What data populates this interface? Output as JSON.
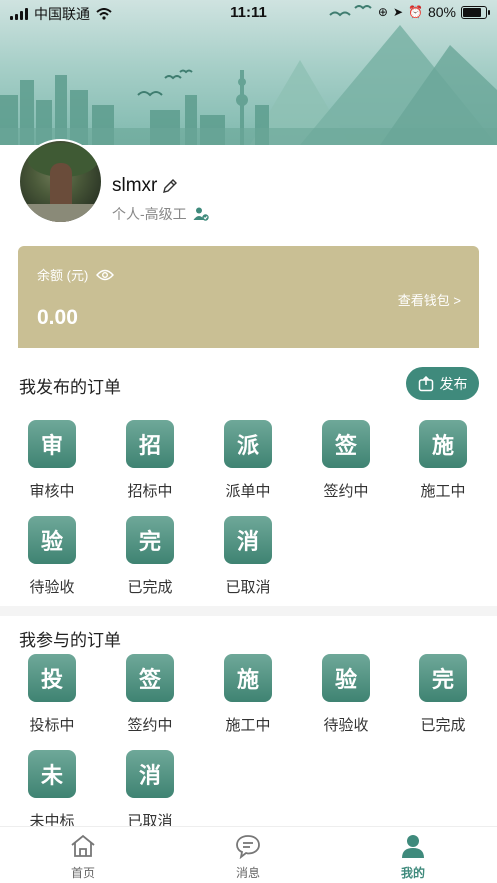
{
  "status_bar": {
    "carrier": "中国联通",
    "time": "11:11",
    "battery": "80%"
  },
  "profile": {
    "username": "slmxr",
    "role": "个人-高级工"
  },
  "balance": {
    "label": "余额 (元)",
    "value": "0.00",
    "wallet_link": "查看钱包 >"
  },
  "published_orders": {
    "title": "我发布的订单",
    "publish_button": "发布",
    "items": [
      {
        "badge": "审",
        "label": "审核中"
      },
      {
        "badge": "招",
        "label": "招标中"
      },
      {
        "badge": "派",
        "label": "派单中"
      },
      {
        "badge": "签",
        "label": "签约中"
      },
      {
        "badge": "施",
        "label": "施工中"
      },
      {
        "badge": "验",
        "label": "待验收"
      },
      {
        "badge": "完",
        "label": "已完成"
      },
      {
        "badge": "消",
        "label": "已取消"
      }
    ]
  },
  "participated_orders": {
    "title": "我参与的订单",
    "items": [
      {
        "badge": "投",
        "label": "投标中"
      },
      {
        "badge": "签",
        "label": "签约中"
      },
      {
        "badge": "施",
        "label": "施工中"
      },
      {
        "badge": "验",
        "label": "待验收"
      },
      {
        "badge": "完",
        "label": "已完成"
      },
      {
        "badge": "未",
        "label": "未中标"
      },
      {
        "badge": "消",
        "label": "已取消"
      }
    ]
  },
  "tab_bar": {
    "tabs": [
      {
        "label": "首页",
        "icon": "home-icon"
      },
      {
        "label": "消息",
        "icon": "message-icon"
      },
      {
        "label": "我的",
        "icon": "profile-icon",
        "active": true
      }
    ]
  },
  "colors": {
    "accent": "#3f8a7c",
    "balance_card": "#c9bf94"
  }
}
